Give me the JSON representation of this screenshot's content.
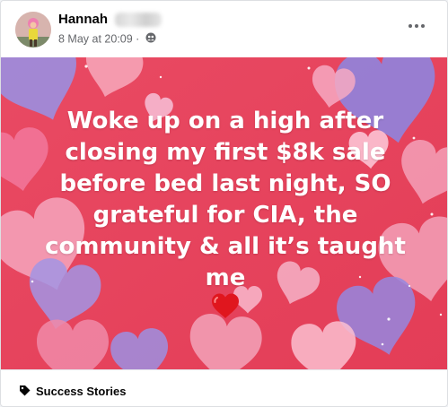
{
  "post": {
    "author_first_name": "Hannah",
    "timestamp": "8 May at 20:09",
    "separator": " · ",
    "audience_icon": "group-icon",
    "more_icon": "more-horizontal-icon",
    "message_lines": [
      "Woke up on a high after",
      "closing my first $8k sale",
      "before bed last night, SO",
      "grateful for CIA, the",
      "community & all it’s taught me"
    ],
    "message_emoji": "red-heart-emoji",
    "background_style": "pink-red-hearts",
    "colors": {
      "background": "#e8475e",
      "text": "#ffffff",
      "meta": "#65676b"
    }
  },
  "topic": {
    "icon": "tag-icon",
    "label": "Success Stories"
  }
}
